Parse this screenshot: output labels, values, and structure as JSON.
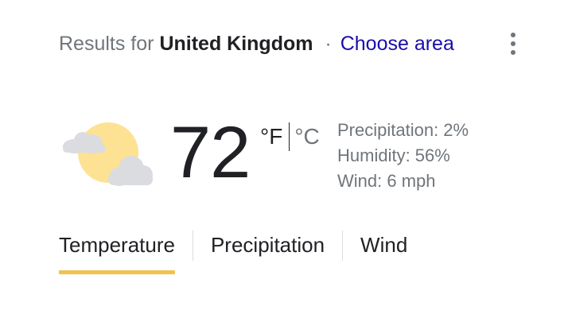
{
  "header": {
    "prefix": "Results for",
    "location": "United Kingdom",
    "separator": "·",
    "choose_area": "Choose area"
  },
  "current": {
    "condition_icon": "partly-cloudy-icon",
    "temperature": "72",
    "unit_f": "°F",
    "unit_c": "°C",
    "precipitation": "Precipitation: 2%",
    "humidity": "Humidity: 56%",
    "wind": "Wind: 6 mph"
  },
  "tabs": [
    {
      "label": "Temperature",
      "active": true
    },
    {
      "label": "Precipitation",
      "active": false
    },
    {
      "label": "Wind",
      "active": false
    }
  ],
  "colors": {
    "sun": "#fde293",
    "cloud": "#dadce0",
    "tab_underline": "#f2c14e",
    "link": "#1a0dab"
  }
}
